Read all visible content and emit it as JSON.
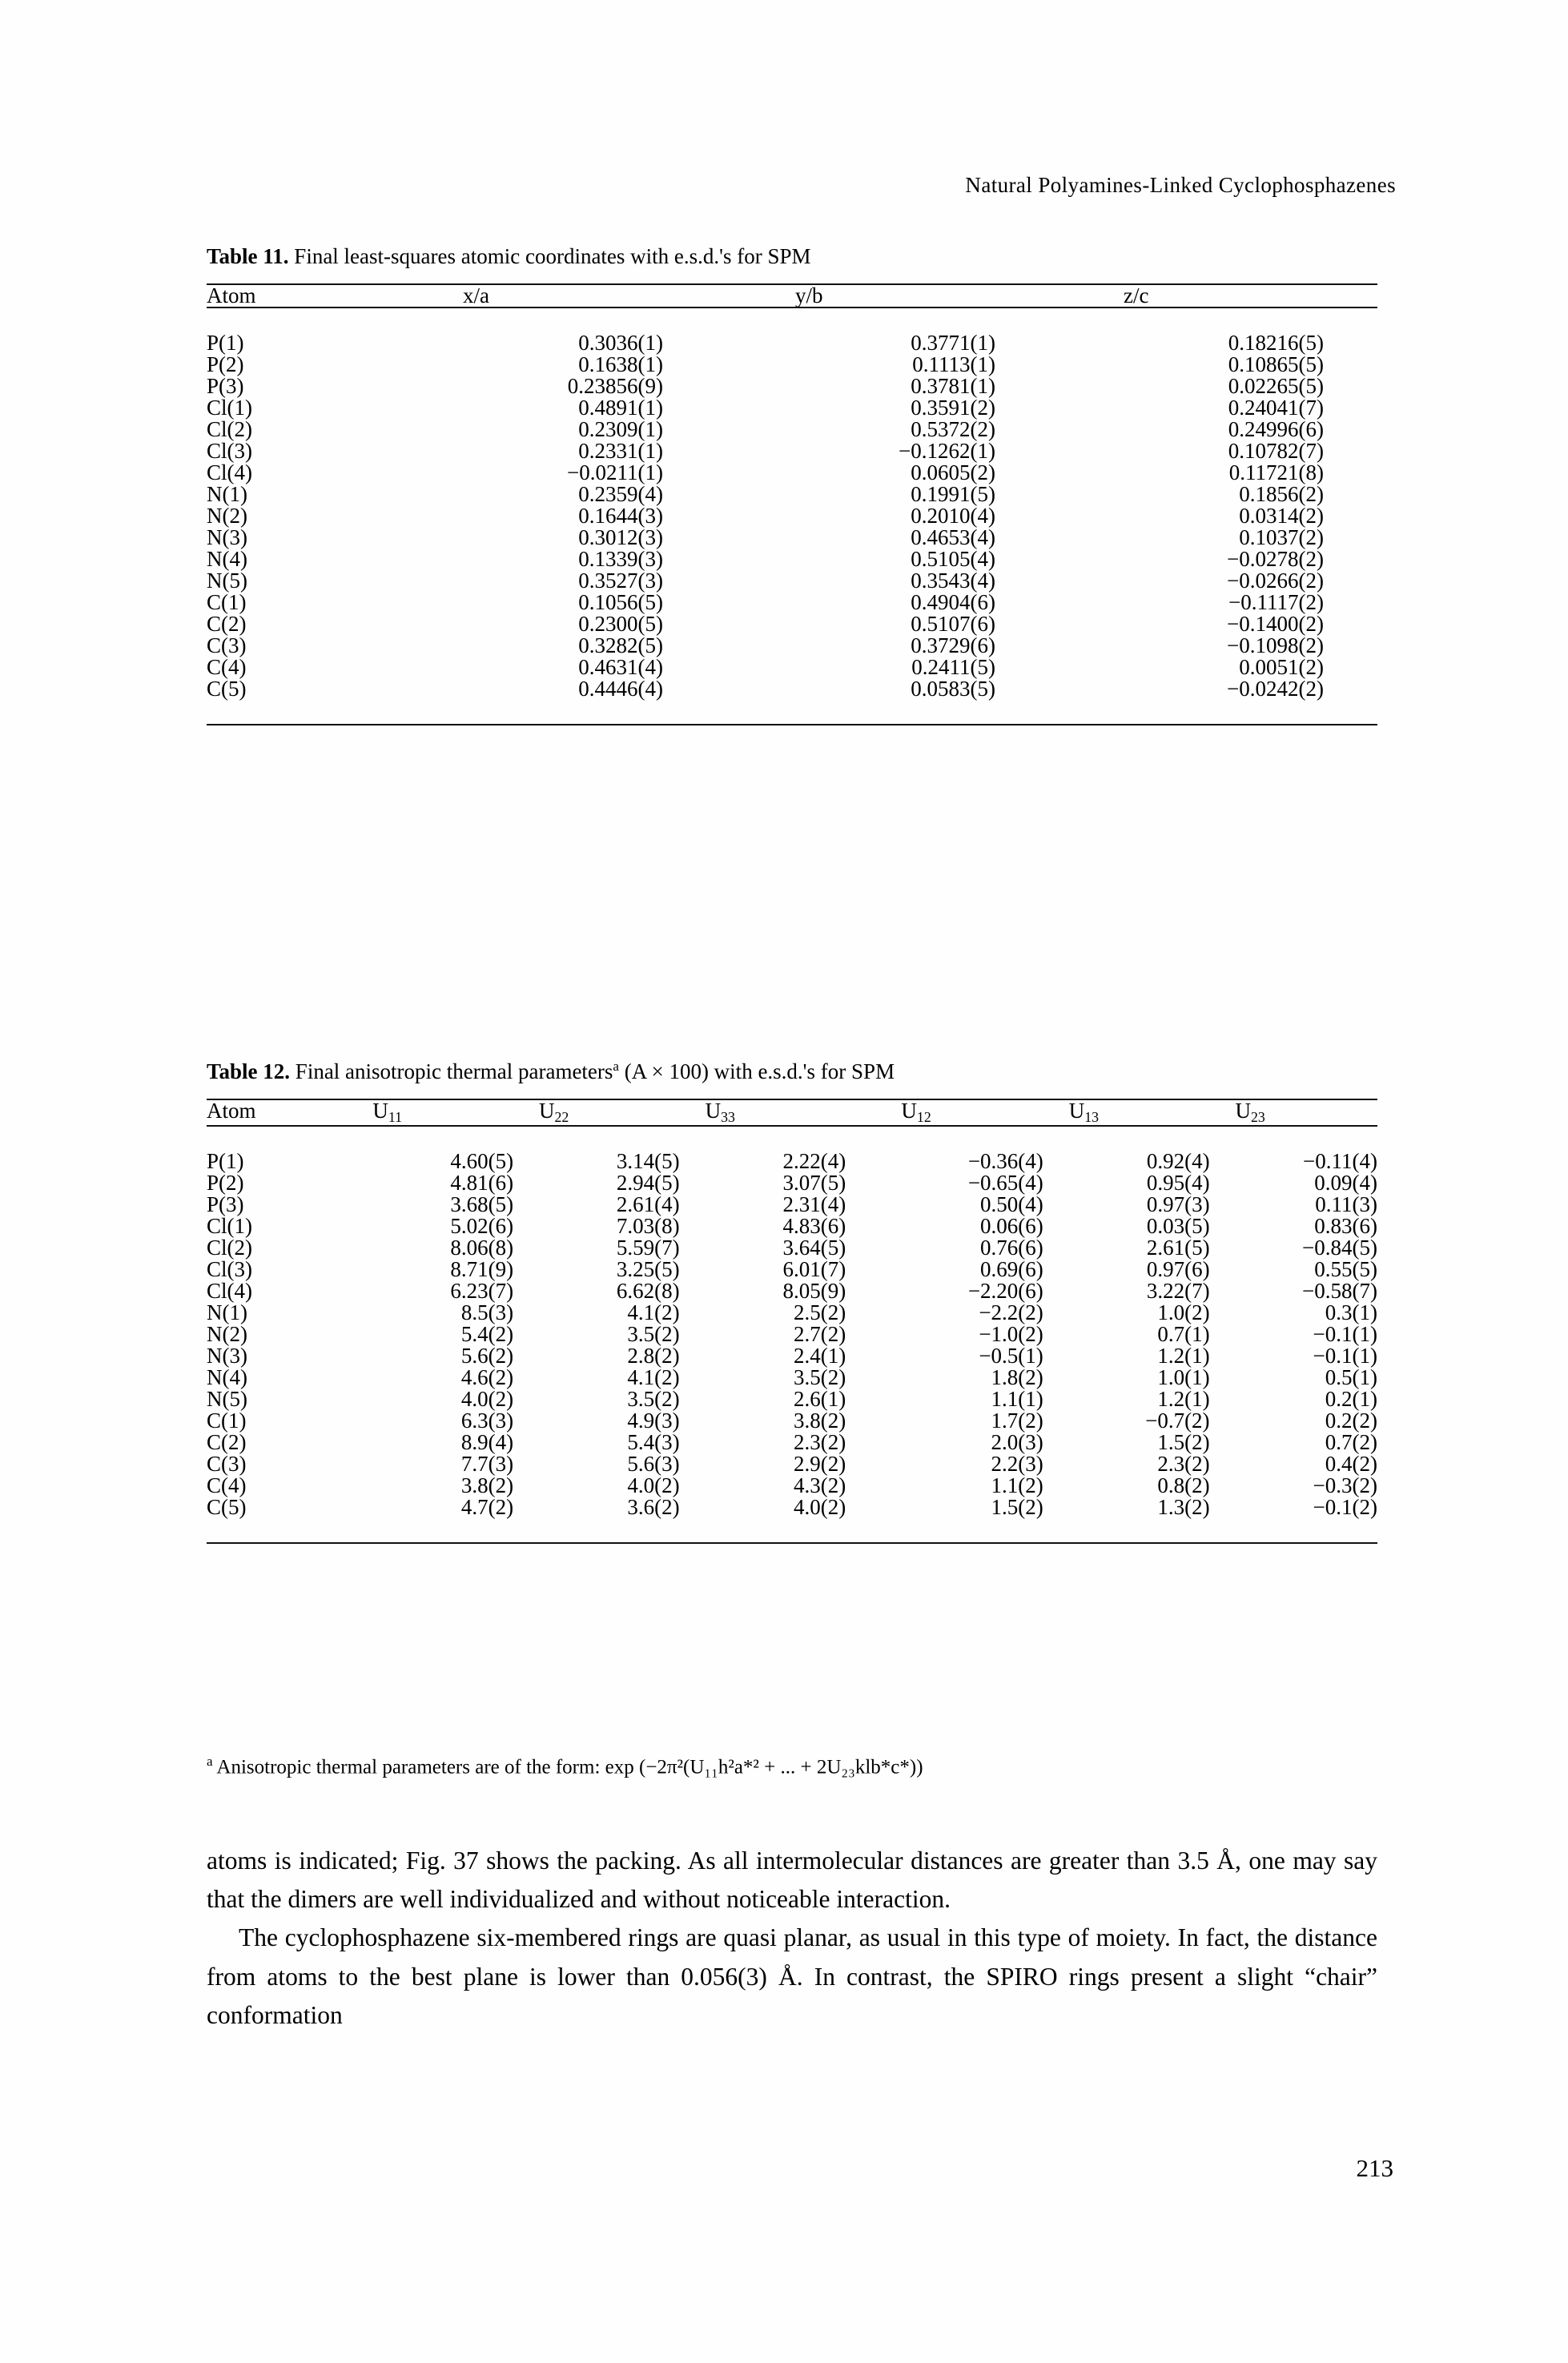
{
  "running_head": "Natural Polyamines-Linked Cyclophosphazenes",
  "page_number": "213",
  "table11": {
    "label": "Table 11.",
    "caption": "Final least-squares atomic coordinates with e.s.d.'s for SPM",
    "columns": [
      "Atom",
      "x/a",
      "y/b",
      "z/c"
    ],
    "rows": [
      {
        "atom": "P(1)",
        "xa": "0.3036(1)",
        "yb": "0.3771(1)",
        "zc": "0.18216(5)"
      },
      {
        "atom": "P(2)",
        "xa": "0.1638(1)",
        "yb": "0.1113(1)",
        "zc": "0.10865(5)"
      },
      {
        "atom": "P(3)",
        "xa": "0.23856(9)",
        "yb": "0.3781(1)",
        "zc": "0.02265(5)"
      },
      {
        "atom": "Cl(1)",
        "xa": "0.4891(1)",
        "yb": "0.3591(2)",
        "zc": "0.24041(7)"
      },
      {
        "atom": "Cl(2)",
        "xa": "0.2309(1)",
        "yb": "0.5372(2)",
        "zc": "0.24996(6)"
      },
      {
        "atom": "Cl(3)",
        "xa": "0.2331(1)",
        "yb": "−0.1262(1)",
        "zc": "0.10782(7)"
      },
      {
        "atom": "Cl(4)",
        "xa": "−0.0211(1)",
        "yb": "0.0605(2)",
        "zc": "0.11721(8)"
      },
      {
        "atom": "N(1)",
        "xa": "0.2359(4)",
        "yb": "0.1991(5)",
        "zc": "0.1856(2)"
      },
      {
        "atom": "N(2)",
        "xa": "0.1644(3)",
        "yb": "0.2010(4)",
        "zc": "0.0314(2)"
      },
      {
        "atom": "N(3)",
        "xa": "0.3012(3)",
        "yb": "0.4653(4)",
        "zc": "0.1037(2)"
      },
      {
        "atom": "N(4)",
        "xa": "0.1339(3)",
        "yb": "0.5105(4)",
        "zc": "−0.0278(2)"
      },
      {
        "atom": "N(5)",
        "xa": "0.3527(3)",
        "yb": "0.3543(4)",
        "zc": "−0.0266(2)"
      },
      {
        "atom": "C(1)",
        "xa": "0.1056(5)",
        "yb": "0.4904(6)",
        "zc": "−0.1117(2)"
      },
      {
        "atom": "C(2)",
        "xa": "0.2300(5)",
        "yb": "0.5107(6)",
        "zc": "−0.1400(2)"
      },
      {
        "atom": "C(3)",
        "xa": "0.3282(5)",
        "yb": "0.3729(6)",
        "zc": "−0.1098(2)"
      },
      {
        "atom": "C(4)",
        "xa": "0.4631(4)",
        "yb": "0.2411(5)",
        "zc": "0.0051(2)"
      },
      {
        "atom": "C(5)",
        "xa": "0.4446(4)",
        "yb": "0.0583(5)",
        "zc": "−0.0242(2)"
      }
    ]
  },
  "table12": {
    "label": "Table 12.",
    "caption_before": "Final anisotropic thermal parameters",
    "caption_mark": "a",
    "caption_after": " (A × 100) with e.s.d.'s for SPM",
    "columns": [
      "Atom",
      "U11",
      "U22",
      "U33",
      "U12",
      "U13",
      "U23"
    ],
    "column_symbols": [
      {
        "base": "U",
        "sub": "11"
      },
      {
        "base": "U",
        "sub": "22"
      },
      {
        "base": "U",
        "sub": "33"
      },
      {
        "base": "U",
        "sub": "12"
      },
      {
        "base": "U",
        "sub": "13"
      },
      {
        "base": "U",
        "sub": "23"
      }
    ],
    "rows": [
      {
        "atom": "P(1)",
        "u11": "4.60(5)",
        "u22": "3.14(5)",
        "u33": "2.22(4)",
        "u12": "−0.36(4)",
        "u13": "0.92(4)",
        "u23": "−0.11(4)"
      },
      {
        "atom": "P(2)",
        "u11": "4.81(6)",
        "u22": "2.94(5)",
        "u33": "3.07(5)",
        "u12": "−0.65(4)",
        "u13": "0.95(4)",
        "u23": "0.09(4)"
      },
      {
        "atom": "P(3)",
        "u11": "3.68(5)",
        "u22": "2.61(4)",
        "u33": "2.31(4)",
        "u12": "0.50(4)",
        "u13": "0.97(3)",
        "u23": "0.11(3)"
      },
      {
        "atom": "Cl(1)",
        "u11": "5.02(6)",
        "u22": "7.03(8)",
        "u33": "4.83(6)",
        "u12": "0.06(6)",
        "u13": "0.03(5)",
        "u23": "0.83(6)"
      },
      {
        "atom": "Cl(2)",
        "u11": "8.06(8)",
        "u22": "5.59(7)",
        "u33": "3.64(5)",
        "u12": "0.76(6)",
        "u13": "2.61(5)",
        "u23": "−0.84(5)"
      },
      {
        "atom": "Cl(3)",
        "u11": "8.71(9)",
        "u22": "3.25(5)",
        "u33": "6.01(7)",
        "u12": "0.69(6)",
        "u13": "0.97(6)",
        "u23": "0.55(5)"
      },
      {
        "atom": "Cl(4)",
        "u11": "6.23(7)",
        "u22": "6.62(8)",
        "u33": "8.05(9)",
        "u12": "−2.20(6)",
        "u13": "3.22(7)",
        "u23": "−0.58(7)"
      },
      {
        "atom": "N(1)",
        "u11": "8.5(3)",
        "u22": "4.1(2)",
        "u33": "2.5(2)",
        "u12": "−2.2(2)",
        "u13": "1.0(2)",
        "u23": "0.3(1)"
      },
      {
        "atom": "N(2)",
        "u11": "5.4(2)",
        "u22": "3.5(2)",
        "u33": "2.7(2)",
        "u12": "−1.0(2)",
        "u13": "0.7(1)",
        "u23": "−0.1(1)"
      },
      {
        "atom": "N(3)",
        "u11": "5.6(2)",
        "u22": "2.8(2)",
        "u33": "2.4(1)",
        "u12": "−0.5(1)",
        "u13": "1.2(1)",
        "u23": "−0.1(1)"
      },
      {
        "atom": "N(4)",
        "u11": "4.6(2)",
        "u22": "4.1(2)",
        "u33": "3.5(2)",
        "u12": "1.8(2)",
        "u13": "1.0(1)",
        "u23": "0.5(1)"
      },
      {
        "atom": "N(5)",
        "u11": "4.0(2)",
        "u22": "3.5(2)",
        "u33": "2.6(1)",
        "u12": "1.1(1)",
        "u13": "1.2(1)",
        "u23": "0.2(1)"
      },
      {
        "atom": "C(1)",
        "u11": "6.3(3)",
        "u22": "4.9(3)",
        "u33": "3.8(2)",
        "u12": "1.7(2)",
        "u13": "−0.7(2)",
        "u23": "0.2(2)"
      },
      {
        "atom": "C(2)",
        "u11": "8.9(4)",
        "u22": "5.4(3)",
        "u33": "2.3(2)",
        "u12": "2.0(3)",
        "u13": "1.5(2)",
        "u23": "0.7(2)"
      },
      {
        "atom": "C(3)",
        "u11": "7.7(3)",
        "u22": "5.6(3)",
        "u33": "2.9(2)",
        "u12": "2.2(3)",
        "u13": "2.3(2)",
        "u23": "0.4(2)"
      },
      {
        "atom": "C(4)",
        "u11": "3.8(2)",
        "u22": "4.0(2)",
        "u33": "4.3(2)",
        "u12": "1.1(2)",
        "u13": "0.8(2)",
        "u23": "−0.3(2)"
      },
      {
        "atom": "C(5)",
        "u11": "4.7(2)",
        "u22": "3.6(2)",
        "u33": "4.0(2)",
        "u12": "1.5(2)",
        "u13": "1.3(2)",
        "u23": "−0.1(2)"
      }
    ],
    "footnote_mark": "a",
    "footnote_text": " Anisotropic thermal parameters are of the form: exp (−2π²(U₁₁h²a*² + ... + 2U₂₃klb*c*))"
  },
  "body": {
    "paragraph1": "atoms is indicated; Fig. 37 shows the packing. As all intermolecular distances are greater than 3.5 Å, one may say that the dimers are well individualized and without noticeable interaction.",
    "paragraph2": "The cyclophosphazene six-membered rings are quasi planar, as usual in this type of moiety. In fact, the distance from atoms to the best plane is lower than 0.056(3) Å. In contrast, the SPIRO rings present a slight “chair” conformation"
  }
}
